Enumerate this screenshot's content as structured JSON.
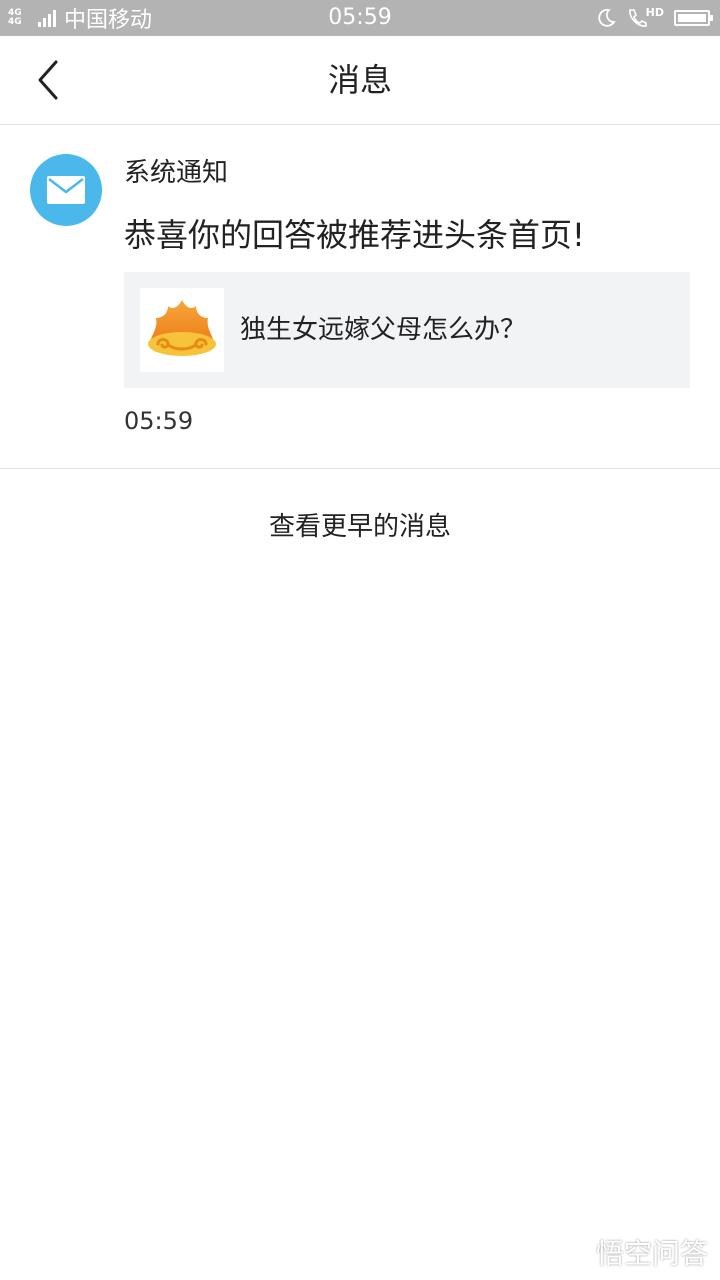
{
  "status_bar": {
    "network_top": "4G",
    "network_bottom": "4G",
    "carrier": "中国移动",
    "time": "05:59",
    "hd": "HD",
    "battery_level": 1.0
  },
  "nav": {
    "title": "消息"
  },
  "message": {
    "sender": "系统通知",
    "title": "恭喜你的回答被推荐进头条首页!",
    "card_text": "独生女远嫁父母怎么办？",
    "time": "05:59"
  },
  "more_link": "查看更早的消息",
  "watermark": "悟空问答",
  "colors": {
    "status_bar": "#b3b3b3",
    "avatar": "#4ab8ea",
    "card_bg": "#f2f3f5",
    "divider": "#e2e2e2"
  }
}
